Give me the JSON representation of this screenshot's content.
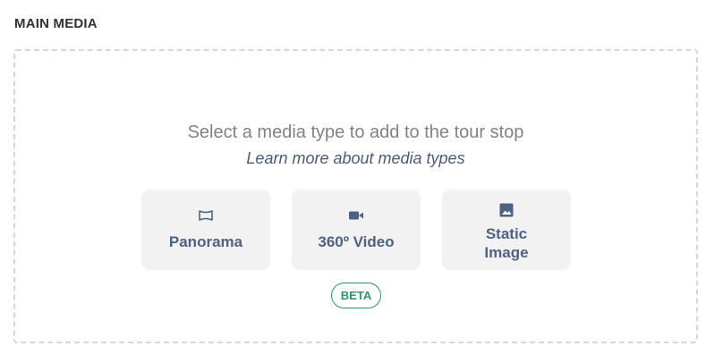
{
  "section": {
    "title": "MAIN MEDIA"
  },
  "dropzone": {
    "prompt": "Select a media type to add to the tour stop",
    "learn_more_link": "Learn more about media types"
  },
  "media_types": [
    {
      "label": "Panorama",
      "icon": "panorama-icon"
    },
    {
      "label": "360º Video",
      "icon": "video-camera-icon"
    },
    {
      "label": "Static Image",
      "icon": "image-icon"
    }
  ],
  "badge": {
    "label": "BETA"
  },
  "colors": {
    "button_text": "#4f6283",
    "button_bg": "#f2f2f2",
    "link": "#4a5b7a",
    "beta_green": "#249a64",
    "dashed_border": "#d6d6d6"
  }
}
